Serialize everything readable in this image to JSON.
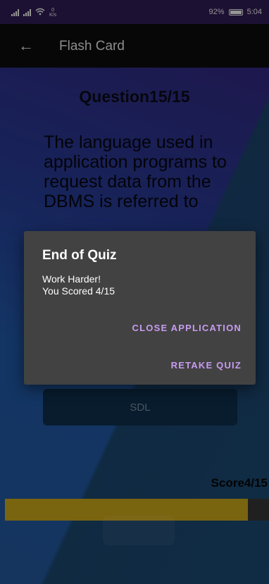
{
  "status_bar": {
    "network_speed_value": "0",
    "network_speed_unit": "K/s",
    "battery": "92%",
    "time": "5:04"
  },
  "app_bar": {
    "title": "Flash Card",
    "back_icon": "arrow-left-icon"
  },
  "question": {
    "number_label": "Question15/15",
    "text": "The language used in application programs to request data from the DBMS is referred to",
    "visible_option": "SDL"
  },
  "score": {
    "label": "Score4/15",
    "progress": 0.92
  },
  "next_button": "",
  "dialog": {
    "title": "End of Quiz",
    "message_line1": "Work Harder!",
    "message_line2": "You Scored 4/15",
    "close_action": "CLOSE APPLICATION",
    "retake_action": "RETAKE QUIZ"
  },
  "colors": {
    "accent": "#c79cf0",
    "progress_fill": "#b39418",
    "dialog_bg": "#424242"
  }
}
